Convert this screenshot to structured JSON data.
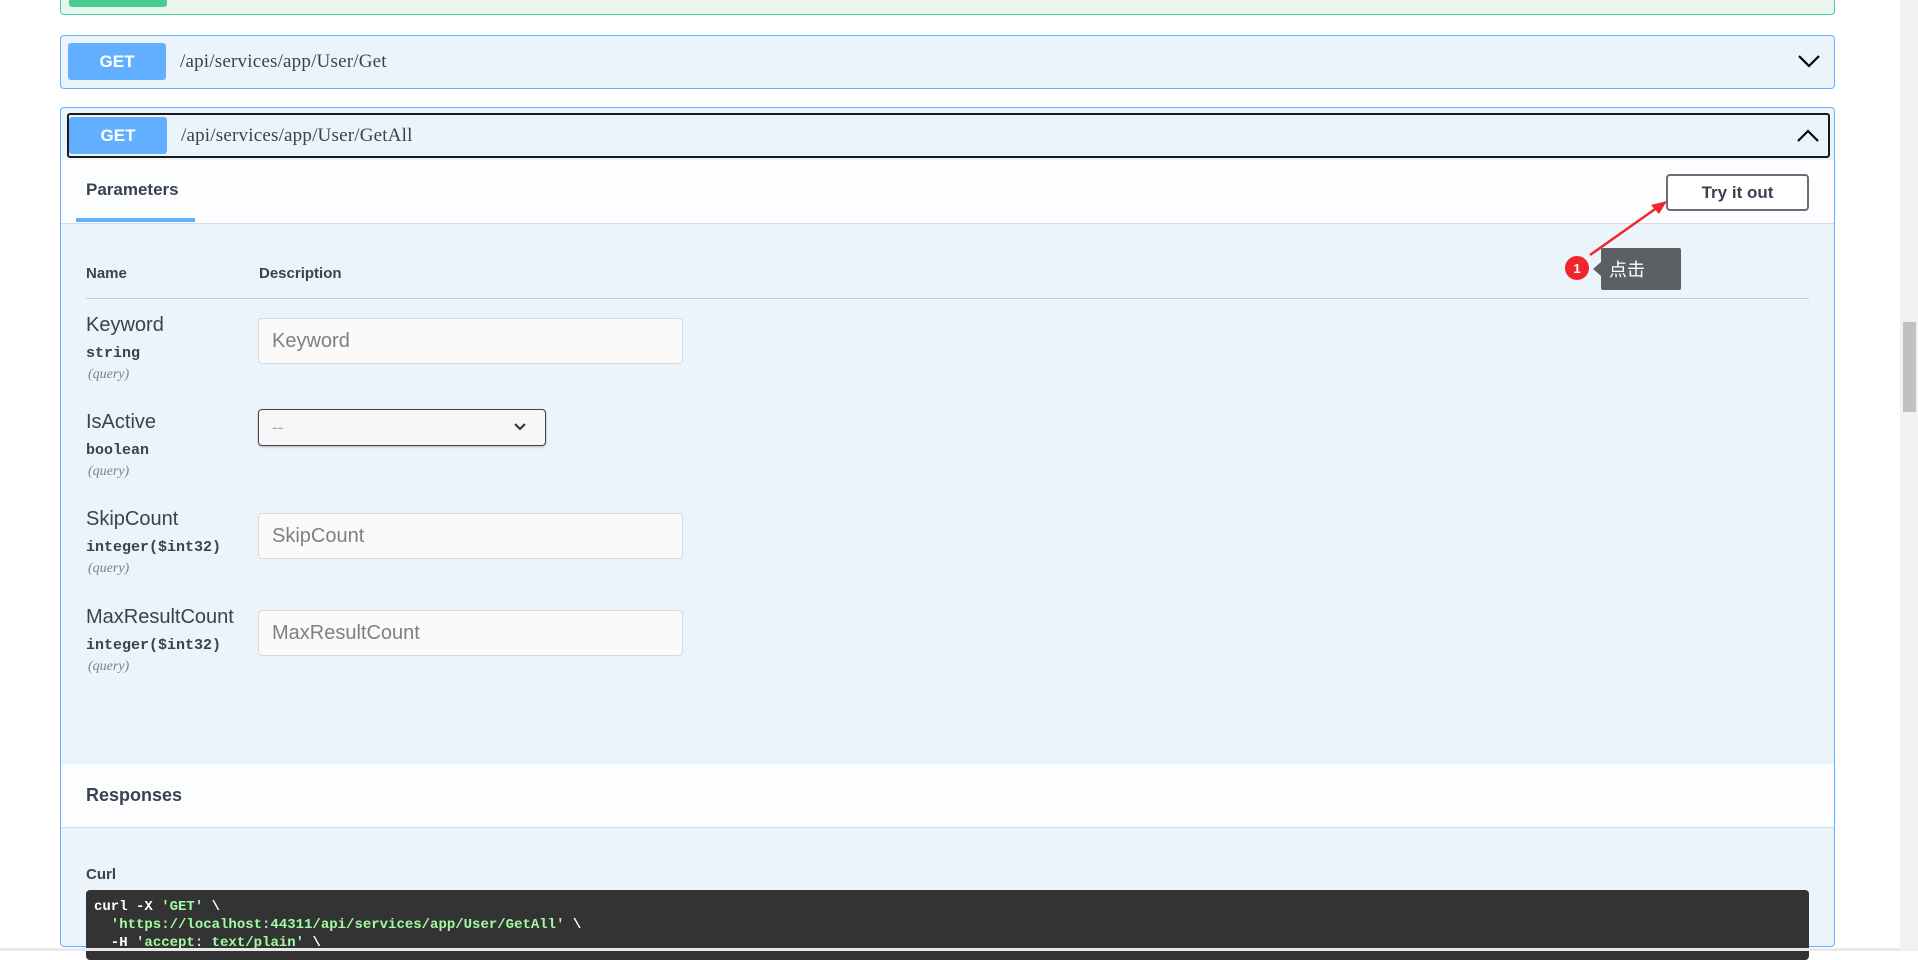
{
  "operations": [
    {
      "method": "GET",
      "path": "/api/services/app/User/Get"
    },
    {
      "method": "GET",
      "path": "/api/services/app/User/GetAll"
    }
  ],
  "params_section": {
    "tab_label": "Parameters",
    "try_label": "Try it out",
    "col_name": "Name",
    "col_desc": "Description"
  },
  "parameters": [
    {
      "name": "Keyword",
      "type": "string",
      "in": "(query)",
      "placeholder": "Keyword"
    },
    {
      "name": "IsActive",
      "type": "boolean",
      "in": "(query)",
      "selected": "--"
    },
    {
      "name": "SkipCount",
      "type": "integer($int32)",
      "in": "(query)",
      "placeholder": "SkipCount"
    },
    {
      "name": "MaxResultCount",
      "type": "integer($int32)",
      "in": "(query)",
      "placeholder": "MaxResultCount"
    }
  ],
  "annotation": {
    "number": "1",
    "text": "点击"
  },
  "responses": {
    "title": "Responses",
    "curl_label": "Curl",
    "curl_line1_cmd": "curl -X ",
    "curl_line1_str": "'GET'",
    "curl_line1_tail": " \\",
    "curl_line2_str": "  'https://localhost:44311/api/services/app/User/GetAll'",
    "curl_line2_tail": " \\",
    "curl_line3_cmd": "  -H ",
    "curl_line3_str": "'accept: text/plain'",
    "curl_line3_tail": " \\"
  },
  "colors": {
    "get": "#61affe",
    "post": "#49cc90",
    "annotation": "#f1262d"
  }
}
